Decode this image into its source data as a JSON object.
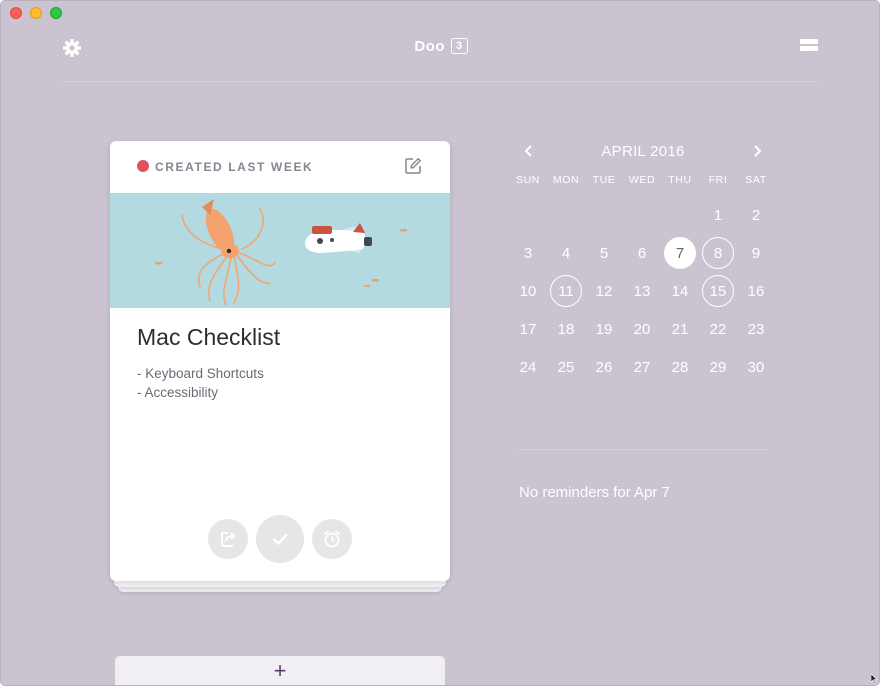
{
  "window": {
    "title": "Doo",
    "badge_count": "3"
  },
  "toolbar": {
    "settings_icon": "gear-icon",
    "menu_icon": "list-view-icon"
  },
  "card": {
    "tag": "CREATED LAST WEEK",
    "tag_color": "#e05262",
    "title": "Mac Checklist",
    "notes": [
      "- Keyboard Shortcuts",
      "- Accessibility"
    ],
    "actions": [
      "reschedule-icon",
      "checkmark-icon",
      "alarm-icon"
    ]
  },
  "add_button": {
    "label": "+"
  },
  "calendar": {
    "month_label": "APRIL 2016",
    "weekdays": [
      "SUN",
      "MON",
      "TUE",
      "WED",
      "THU",
      "FRI",
      "SAT"
    ],
    "weeks": [
      [
        "",
        "",
        "",
        "",
        "",
        "1",
        "2"
      ],
      [
        "3",
        "4",
        "5",
        "6",
        "7",
        "8",
        "9"
      ],
      [
        "10",
        "11",
        "12",
        "13",
        "14",
        "15",
        "16"
      ],
      [
        "17",
        "18",
        "19",
        "20",
        "21",
        "22",
        "23"
      ],
      [
        "24",
        "25",
        "26",
        "27",
        "28",
        "29",
        "30"
      ]
    ],
    "today": "7",
    "marked_days": [
      "8",
      "11",
      "15"
    ]
  },
  "reminders": {
    "empty_text": "No reminders for Apr 7"
  },
  "colors": {
    "background": "#cbc3d0",
    "accent": "#5a3f6b"
  }
}
